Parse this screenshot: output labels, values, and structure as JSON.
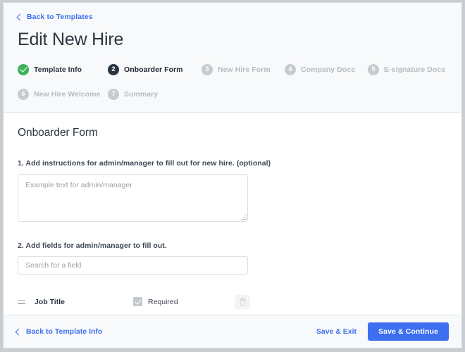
{
  "header": {
    "back_link": "Back to Templates",
    "title": "Edit New Hire"
  },
  "stepper": {
    "steps": [
      {
        "num": "1",
        "label": "Template Info",
        "state": "done"
      },
      {
        "num": "2",
        "label": "Onboarder Form",
        "state": "active"
      },
      {
        "num": "3",
        "label": "New Hire Form",
        "state": "todo"
      },
      {
        "num": "4",
        "label": "Company Docs",
        "state": "todo"
      },
      {
        "num": "5",
        "label": "E-signature Docs",
        "state": "todo"
      },
      {
        "num": "6",
        "label": "New Hire Welcome",
        "state": "todo"
      },
      {
        "num": "7",
        "label": "Summary",
        "state": "todo"
      }
    ]
  },
  "main": {
    "section_title": "Onboarder Form",
    "question_1": "1. Add instructions for admin/manager to fill out for new hire. (optional)",
    "instructions_value": "",
    "instructions_placeholder": "Example text for admin/manager",
    "question_2": "2. Add fields for admin/manager to fill out.",
    "search_value": "",
    "search_placeholder": "Search for a field",
    "fields": [
      {
        "name": "Job Title",
        "required_label": "Required",
        "required": true
      }
    ]
  },
  "footer": {
    "back_label": "Back to Template Info",
    "save_exit_label": "Save & Exit",
    "save_continue_label": "Save & Continue"
  },
  "colors": {
    "accent_blue": "#3d6ff0",
    "step_done_green": "#3cb35b",
    "step_active_navy": "#2a3440",
    "step_todo_gray": "#c6cbd1"
  }
}
